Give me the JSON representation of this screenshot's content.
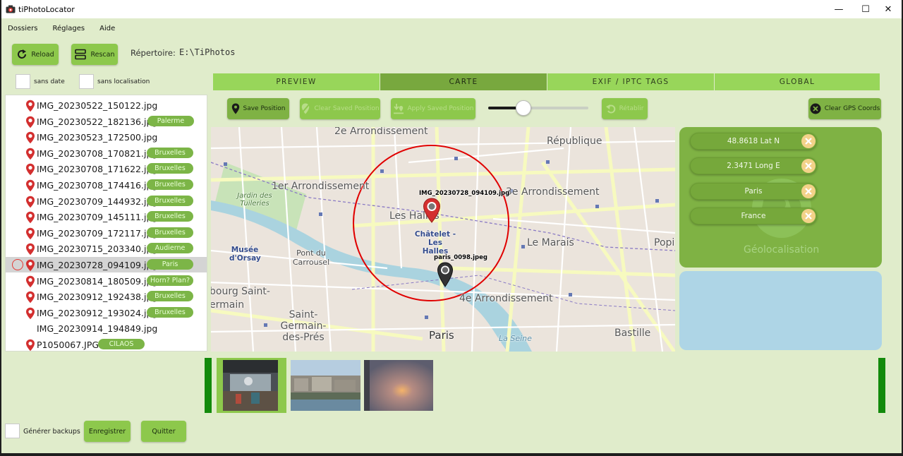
{
  "window": {
    "title": "tiPhotoLocator",
    "controls": {
      "minimize": "—",
      "maximize": "☐",
      "close": "✕"
    }
  },
  "menu": {
    "items": [
      "Dossiers",
      "Réglages",
      "Aide"
    ]
  },
  "toolbar": {
    "reload_label": "Reload",
    "rescan_label": "Rescan",
    "repertoire_label": "Répertoire:",
    "repertoire_value": "E:\\TiPhotos"
  },
  "filters": {
    "sans_date": "sans date",
    "sans_localisation": "sans localisation"
  },
  "tabs": [
    "PREVIEW",
    "CARTE",
    "EXIF / IPTC TAGS",
    "GLOBAL"
  ],
  "active_tab": "CARTE",
  "map_toolbar": {
    "save_position": "Save Position",
    "clear_saved_position": "Clear Saved Position",
    "apply_saved_position": "Apply Saved Position",
    "retablir": "Rétablir",
    "clear_gps_coords": "Clear GPS Coords",
    "zoom_level": 0.35
  },
  "files": [
    {
      "name": "IMG_20230522_150122.jpg",
      "pin": true,
      "location": ""
    },
    {
      "name": "IMG_20230522_182136.jpg",
      "pin": true,
      "location": "Palerme"
    },
    {
      "name": "IMG_20230523_172500.jpg",
      "pin": true,
      "location": ""
    },
    {
      "name": "IMG_20230708_170821.jpg",
      "pin": true,
      "location": "Bruxelles"
    },
    {
      "name": "IMG_20230708_171622.jpg",
      "pin": true,
      "location": "Bruxelles"
    },
    {
      "name": "IMG_20230708_174416.jpg",
      "pin": true,
      "location": "Bruxelles"
    },
    {
      "name": "IMG_20230709_144932.jpg",
      "pin": true,
      "location": "Bruxelles"
    },
    {
      "name": "IMG_20230709_145111.jpg",
      "pin": true,
      "location": "Bruxelles"
    },
    {
      "name": "IMG_20230709_172117.jpg",
      "pin": true,
      "location": "Bruxelles"
    },
    {
      "name": "IMG_20230715_203340.jpg",
      "pin": true,
      "location": "Audierne"
    },
    {
      "name": "IMG_20230728_094109.jpg",
      "pin": true,
      "location": "Paris",
      "selected": true
    },
    {
      "name": "IMG_20230814_180509.jpg",
      "pin": true,
      "location": "Horn? Plan?"
    },
    {
      "name": "IMG_20230912_192438.jpg",
      "pin": true,
      "location": "Bruxelles"
    },
    {
      "name": "IMG_20230912_193024.jpg",
      "pin": true,
      "location": "Bruxelles"
    },
    {
      "name": "IMG_20230914_194849.jpg",
      "pin": false,
      "location": ""
    },
    {
      "name": "P1050067.JPG",
      "pin": true,
      "location": "CILAOS"
    }
  ],
  "map": {
    "labels": {
      "arr2": "2e Arrondissement",
      "republique": "République",
      "arr1": "1er Arrondissement",
      "arr3": "3e Arrondissement",
      "tuileries": "Jardin des Tuileries",
      "les_halles": "Les Halles",
      "chatelet": "Châtelet - Les Halles",
      "le_marais": "Le Marais",
      "popi": "Popi",
      "musee_orsay": "Musée d'Orsay",
      "pont_carrousel": "Pont du Carrousel",
      "bourg_saint": "bourg Saint-",
      "ermain": "ermain",
      "saint_germain": "Saint-Germain-des-Prés",
      "arr4": "4e Arrondissement",
      "paris": "Paris",
      "bastille": "Bastille",
      "seine": "La Seine"
    },
    "markers": {
      "selected_label": "IMG_20230728_094109.jpg",
      "other_label": "paris_0098.jpeg"
    }
  },
  "geolocation": {
    "latitude": "48.8618 Lat N",
    "longitude": "2.3471 Long E",
    "city": "Paris",
    "country": "France",
    "panel_title": "Géolocalisation"
  },
  "bottom": {
    "backup_label": "Générer backups",
    "save_label": "Enregistrer",
    "quit_label": "Quitter"
  },
  "colors": {
    "accent": "#8dc84c",
    "accent_dark": "#7fb244",
    "pin_red": "#d32f2f",
    "background": "#e0eccb",
    "blue_panel": "#aed5e6"
  }
}
